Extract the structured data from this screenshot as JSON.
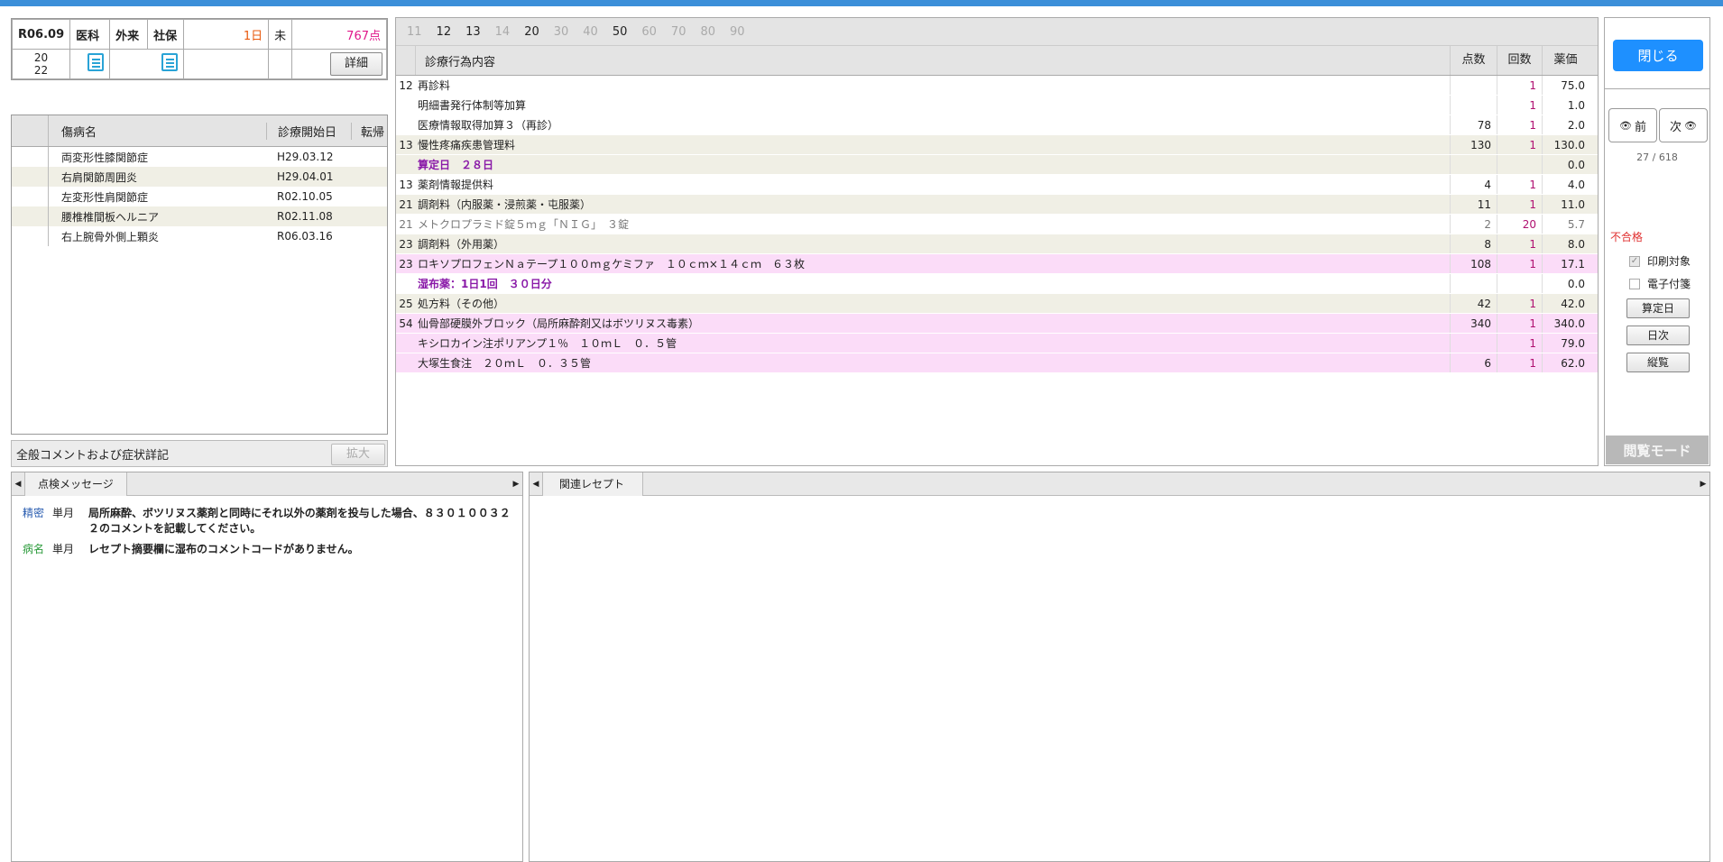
{
  "header": {
    "era_date": "R06.09",
    "dept": "医科",
    "visit_type": "外来",
    "insurance": "社保",
    "days": "1日",
    "status": "未",
    "points": "767点",
    "number_top": "20",
    "number_bottom": "22",
    "detail_btn": "詳細"
  },
  "diseases": {
    "headers": {
      "name": "傷病名",
      "start": "診療開始日",
      "outcome": "転帰"
    },
    "rows": [
      {
        "name": "両変形性膝関節症",
        "date": "H29.03.12"
      },
      {
        "name": "右肩関節周囲炎",
        "date": "H29.04.01"
      },
      {
        "name": "左変形性肩関節症",
        "date": "R02.10.05"
      },
      {
        "name": "腰椎椎間板ヘルニア",
        "date": "R02.11.08"
      },
      {
        "name": "右上腕骨外側上顆炎",
        "date": "R06.03.16"
      }
    ]
  },
  "comment_bar": {
    "label": "全般コメントおよび症状詳記",
    "expand_btn": "拡大"
  },
  "tabs": [
    "11",
    "12",
    "13",
    "14",
    "20",
    "30",
    "40",
    "50",
    "60",
    "70",
    "80",
    "90"
  ],
  "treat_headers": {
    "name": "診療行為内容",
    "points": "点数",
    "count": "回数",
    "price": "薬価"
  },
  "treatments": [
    {
      "code": "12",
      "name": "再診料",
      "pts": "",
      "cnt": "1",
      "price": "75.0",
      "style": ""
    },
    {
      "code": "",
      "name": "明細書発行体制等加算",
      "pts": "",
      "cnt": "1",
      "price": "1.0",
      "style": ""
    },
    {
      "code": "",
      "name": "医療情報取得加算３（再診）",
      "pts": "78",
      "cnt": "1",
      "price": "2.0",
      "style": ""
    },
    {
      "code": "13",
      "name": "慢性疼痛疾患管理料",
      "pts": "130",
      "cnt": "1",
      "price": "130.0",
      "style": "alt"
    },
    {
      "code": "",
      "name": "算定日　２８日",
      "pts": "",
      "cnt": "",
      "price": "0.0",
      "style": "alt",
      "purple": true
    },
    {
      "code": "13",
      "name": "薬剤情報提供料",
      "pts": "4",
      "cnt": "1",
      "price": "4.0",
      "style": ""
    },
    {
      "code": "21",
      "name": "調剤料（内服薬・浸煎薬・屯服薬）",
      "pts": "11",
      "cnt": "1",
      "price": "11.0",
      "style": "alt"
    },
    {
      "code": "21",
      "name": "メトクロプラミド錠５ｍｇ「ＮＩＧ」　３錠",
      "pts": "2",
      "cnt": "20",
      "price": "5.7",
      "style": "",
      "gray": true
    },
    {
      "code": "23",
      "name": "調剤料（外用薬）",
      "pts": "8",
      "cnt": "1",
      "price": "8.0",
      "style": "alt"
    },
    {
      "code": "23",
      "name": "ロキソプロフェンＮａテープ１００ｍｇケミファ　１０ｃｍ×１４ｃｍ　６３枚",
      "pts": "108",
      "cnt": "1",
      "price": "17.1",
      "style": "pk"
    },
    {
      "code": "",
      "name": "湿布薬：1日1回　３０日分",
      "pts": "",
      "cnt": "",
      "price": "0.0",
      "style": "",
      "purple": true
    },
    {
      "code": "25",
      "name": "処方料（その他）",
      "pts": "42",
      "cnt": "1",
      "price": "42.0",
      "style": "alt"
    },
    {
      "code": "54",
      "name": "仙骨部硬膜外ブロック（局所麻酔剤又はボツリヌス毒素）",
      "pts": "340",
      "cnt": "1",
      "price": "340.0",
      "style": "pk"
    },
    {
      "code": "",
      "name": "キシロカイン注ポリアンプ１％　１０ｍＬ　０．５管",
      "pts": "",
      "cnt": "1",
      "price": "79.0",
      "style": "pk"
    },
    {
      "code": "",
      "name": "大塚生食注　２０ｍＬ　０．３５管",
      "pts": "6",
      "cnt": "1",
      "price": "62.0",
      "style": "pk"
    }
  ],
  "side": {
    "close_btn": "閉じる",
    "prev_btn": "前",
    "next_btn": "次",
    "counter": "27 / 618",
    "fail_label": "不合格",
    "print_target": "印刷対象",
    "e_attach": "電子付箋",
    "calc_day_btn": "算定日",
    "daily_btn": "日次",
    "overview_btn": "縦覧",
    "mode_label": "閲覧モード"
  },
  "check": {
    "tab": "点検メッセージ",
    "messages": [
      {
        "kind": "精密",
        "term": "単月",
        "text": "局所麻酔、ボツリヌス薬剤と同時にそれ以外の薬剤を投与した場合、８３０１００３２２のコメントを記載してください。",
        "color": "blue"
      },
      {
        "kind": "病名",
        "term": "単月",
        "text": "レセプト摘要欄に湿布のコメントコードがありません。",
        "color": "green"
      }
    ]
  },
  "related": {
    "tab": "関連レセプト"
  },
  "colors": {
    "accent": "#1e90ff",
    "topbar": "#3b8fd9",
    "pink_row": "#fbdcf8",
    "alt_row": "#f0efe5"
  }
}
